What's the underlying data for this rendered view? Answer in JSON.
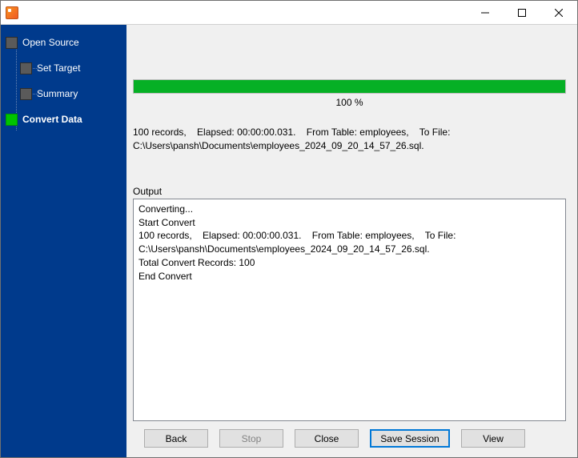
{
  "window": {
    "title": ""
  },
  "sidebar": {
    "steps": [
      {
        "label": "Open Source"
      },
      {
        "label": "Set Target"
      },
      {
        "label": "Summary"
      },
      {
        "label": "Convert Data"
      }
    ]
  },
  "progress": {
    "percent": 100,
    "percent_text": "100 %"
  },
  "summary_line": "100 records,    Elapsed: 00:00:00.031.    From Table: employees,    To File: C:\\Users\\pansh\\Documents\\employees_2024_09_20_14_57_26.sql.",
  "output_label": "Output",
  "output_text": "Converting...\nStart Convert\n100 records,    Elapsed: 00:00:00.031.    From Table: employees,    To File: C:\\Users\\pansh\\Documents\\employees_2024_09_20_14_57_26.sql.\nTotal Convert Records: 100\nEnd Convert",
  "buttons": {
    "back": "Back",
    "stop": "Stop",
    "close": "Close",
    "save_session": "Save Session",
    "view": "View"
  }
}
